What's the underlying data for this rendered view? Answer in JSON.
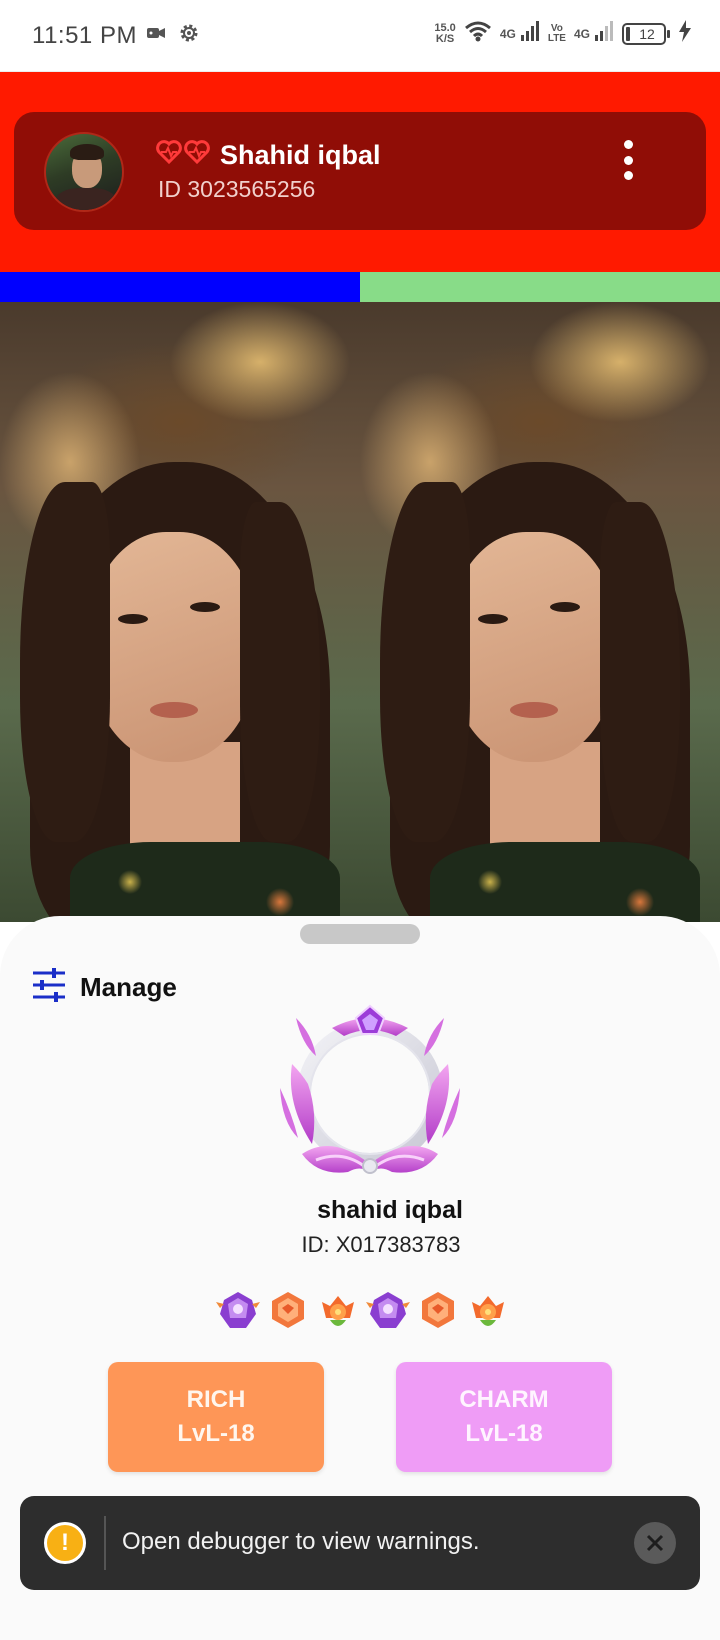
{
  "status_bar": {
    "time": "11:51 PM",
    "net_speed_value": "15.0",
    "net_speed_unit": "K/S",
    "sim1_label": "4G",
    "volte_top": "Vo",
    "volte_bottom": "LTE",
    "sim2_label": "4G",
    "battery_level": "12",
    "icons": [
      "video-camera-icon",
      "settings-gear-icon",
      "wifi-icon",
      "signal-icon",
      "charging-bolt-icon"
    ]
  },
  "header": {
    "name": "Shahid iqbal",
    "id_text": "ID 3023565256",
    "heart_icons": [
      "heart-icon",
      "heart-icon"
    ],
    "menu_icon": "more-vertical-icon",
    "background_color": "#ff1a00",
    "card_color": "#900d06"
  },
  "color_bars": {
    "left_color": "#0000ff",
    "right_color": "#88dc88"
  },
  "sheet": {
    "manage_label": "Manage",
    "manage_icon": "sliders-icon",
    "user_name": "shahid iqbal",
    "user_id": "ID: X017383783",
    "badges": [
      "purple-crest-badge",
      "orange-hexagon-badge",
      "flower-emblem-badge",
      "purple-crest-badge",
      "orange-hexagon-badge",
      "flower-emblem-badge"
    ],
    "rich": {
      "title": "RICH",
      "level": "LvL-18",
      "color": "#fe9657"
    },
    "charm": {
      "title": "CHARM",
      "level": "LvL-18",
      "color": "#ef9cf6"
    }
  },
  "toast": {
    "message": "Open debugger to view warnings.",
    "warn_glyph": "!",
    "close_icon": "close-icon"
  }
}
